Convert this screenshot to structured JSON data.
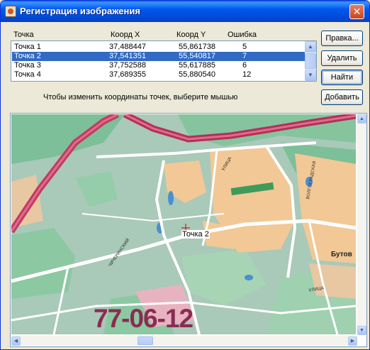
{
  "window": {
    "title": "Регистрация изображения",
    "close_glyph": "✕"
  },
  "table": {
    "columns": [
      "Точка",
      "Коорд X",
      "Коорд Y",
      "Ошибка"
    ],
    "rows": [
      {
        "name": "Точка 1",
        "x": "37,488447",
        "y": "55,861738",
        "error": "5",
        "selected": false
      },
      {
        "name": "Точка 2",
        "x": "37,541351",
        "y": "55,540817",
        "error": "7",
        "selected": true
      },
      {
        "name": "Точка 3",
        "x": "37,752588",
        "y": "55,617885",
        "error": "6",
        "selected": false
      },
      {
        "name": "Точка 4",
        "x": "37,689355",
        "y": "55,880540",
        "error": "12",
        "selected": false
      }
    ]
  },
  "buttons": {
    "edit": "Правка...",
    "delete": "Удалить",
    "find": "Найти",
    "add": "Добавить"
  },
  "hint": "Чтобы изменить координаты точек, выберите мышью",
  "map": {
    "point_label": "Точка 2",
    "code_text": "77-06-12",
    "place_label": "Бутов",
    "colors": {
      "road": "#c23a62",
      "district": "#f2c896",
      "park": "#6fb98e",
      "base": "#a9c9b9",
      "water": "#4a8fd0"
    }
  },
  "icons": {
    "app": "map-app-icon",
    "close": "close-icon",
    "up": "scroll-up-arrow-icon",
    "down": "scroll-down-arrow-icon",
    "marker": "crosshair-marker-icon"
  }
}
